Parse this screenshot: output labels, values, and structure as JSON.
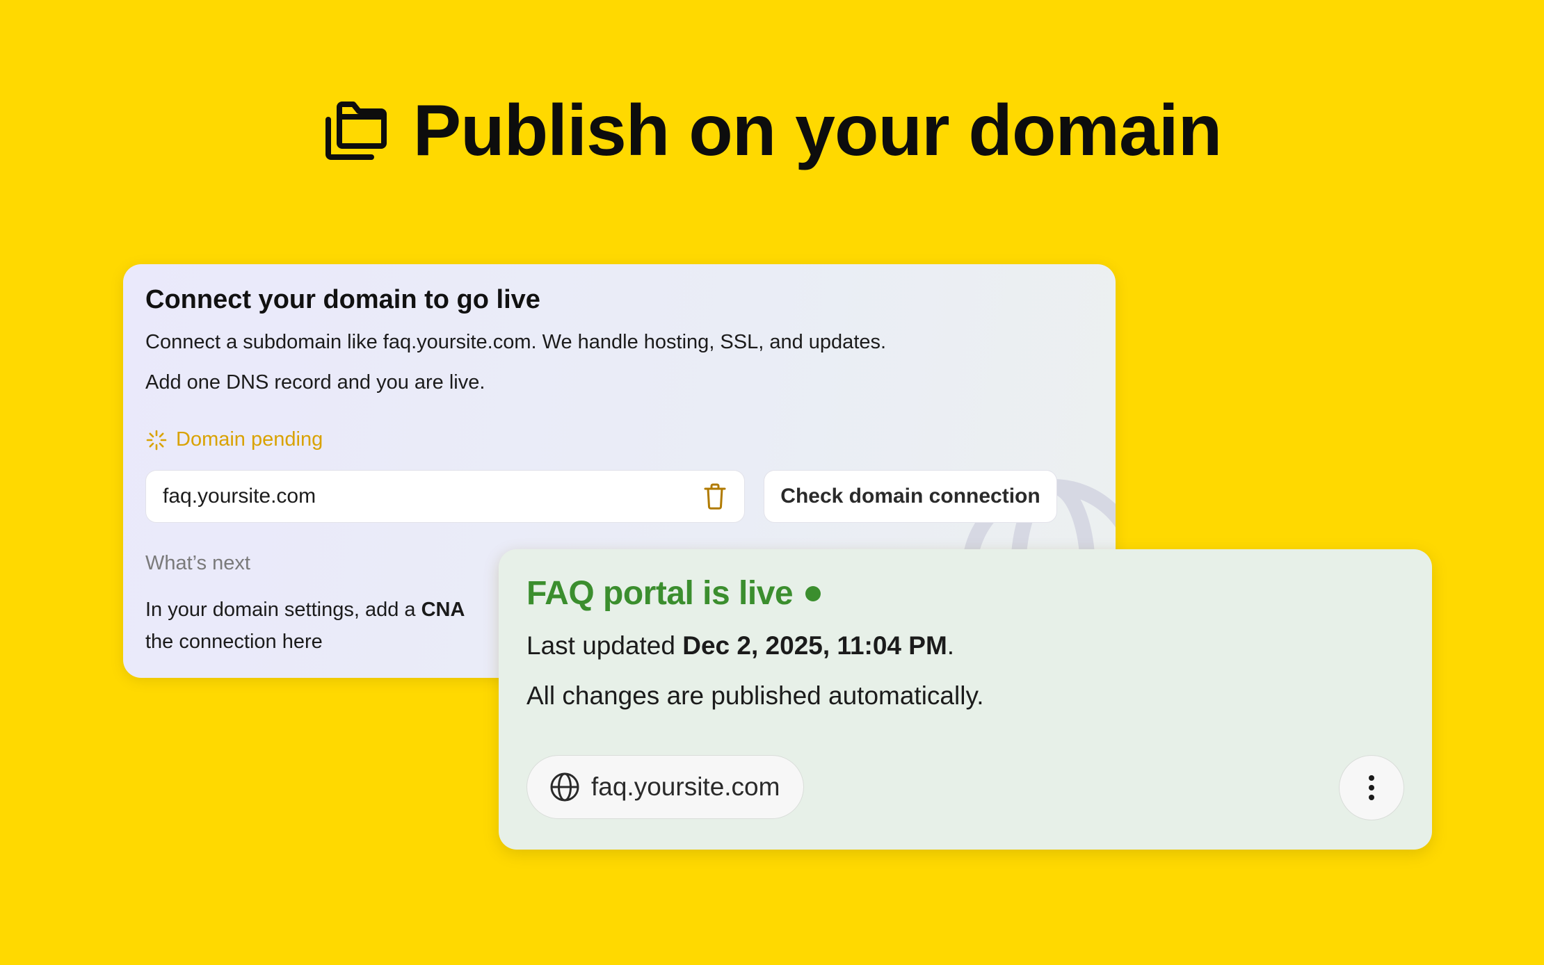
{
  "headline": {
    "icon": "folder-stack-icon",
    "text": "Publish on your domain"
  },
  "connect_card": {
    "title": "Connect your domain to go live",
    "description_line1": "Connect a subdomain like faq.yoursite.com. We handle hosting, SSL, and updates.",
    "description_line2": "Add one DNS record and you are live.",
    "status": {
      "icon": "spinner-icon",
      "label": "Domain pending",
      "color": "#D9A200"
    },
    "domain_input": {
      "value": "faq.yoursite.com",
      "delete_icon": "trash-icon"
    },
    "check_button_label": "Check domain connection",
    "whats_next_label": "What’s next",
    "whats_next_text_start": "In your domain settings, add a ",
    "whats_next_text_bold": "CNA",
    "whats_next_text_line2": "the connection here"
  },
  "live_card": {
    "title": "FAQ portal is live",
    "title_color": "#3B8E2E",
    "last_updated_prefix": "Last updated ",
    "last_updated_value": "Dec 2, 2025, 11:04 PM",
    "last_updated_suffix": ".",
    "auto_publish_text": "All changes are published automatically.",
    "domain_pill": {
      "icon": "globe-icon",
      "text": "faq.yoursite.com"
    },
    "more_button_icon": "more-vertical-icon"
  },
  "colors": {
    "background": "#FFD900",
    "connect_card_bg": "#EAEBF8",
    "live_card_bg": "#E7F0E8"
  }
}
